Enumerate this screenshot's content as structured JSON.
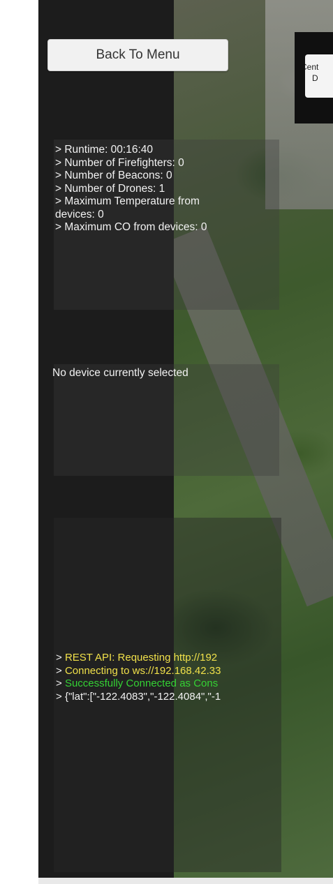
{
  "header": {
    "back_label": "Back To Menu",
    "center_label_line1": "Cent",
    "center_label_line2": "D"
  },
  "stats": {
    "lines": [
      "> Runtime: 00:16:40",
      "> Number of Firefighters: 0",
      "> Number of Beacons: 0",
      "> Number of Drones: 1",
      "> Maximum Temperature from",
      "devices: 0",
      "> Maximum CO from devices: 0"
    ]
  },
  "device": {
    "status": "No device currently selected"
  },
  "console": {
    "prefix": ">",
    "logs": [
      {
        "text": "REST API: Requesting http://192",
        "color": "#f0e04a"
      },
      {
        "text": "Connecting to ws://192.168.42.33",
        "color": "#f0e04a"
      },
      {
        "text": "Successfully Connected as Cons",
        "color": "#34d234"
      },
      {
        "text": "{\"lat\":[\"-122.4083\",\"-122.4084\",\"-1",
        "color": "#f2f2f2"
      }
    ]
  },
  "colors": {
    "sidebar": "#1c1c1c",
    "log_warning": "#f0e04a",
    "log_success": "#34d234"
  }
}
